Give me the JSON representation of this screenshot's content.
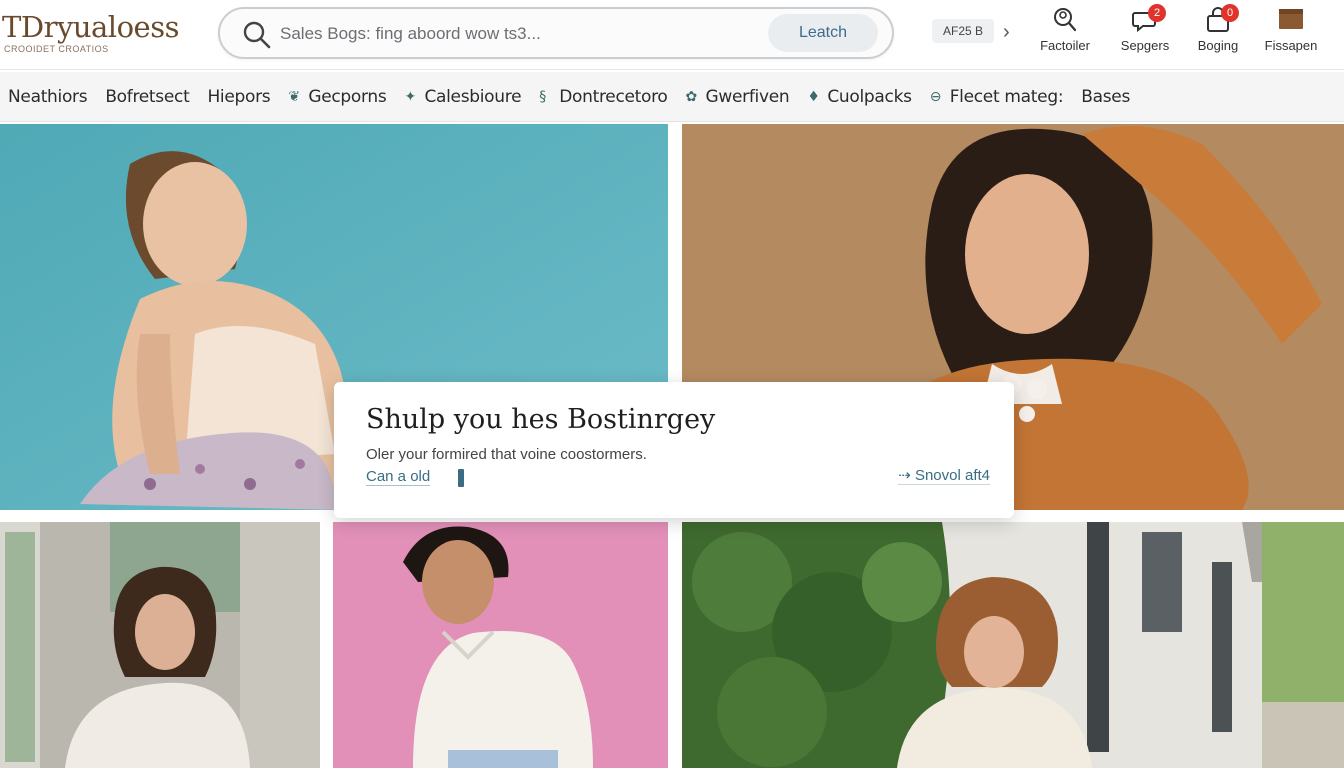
{
  "header": {
    "logo_text": "TDryualoess",
    "logo_tagline": "CROOIDET CROATIOS",
    "search": {
      "placeholder": "Sales Bogs: fing aboord wow ts3...",
      "button_label": "Leatch"
    },
    "locale_label": "AF25 B",
    "icons": [
      {
        "name": "search-person-icon",
        "label": "Factoiler",
        "badge": ""
      },
      {
        "name": "chat-icon",
        "label": "Sepgers",
        "badge": "2"
      },
      {
        "name": "bag-icon",
        "label": "Boging",
        "badge": "0"
      },
      {
        "name": "box-icon",
        "label": "Fissapen",
        "badge": ""
      }
    ]
  },
  "categories": [
    {
      "label": "Neathiors",
      "icon": ""
    },
    {
      "label": "Bofretsect",
      "icon": ""
    },
    {
      "label": "Hiepors",
      "icon": ""
    },
    {
      "label": "Gecporns",
      "icon": "leaf-icon"
    },
    {
      "label": "Calesbioure",
      "icon": "star-icon"
    },
    {
      "label": "Dontrecetoro",
      "icon": "tag-icon"
    },
    {
      "label": "Gwerfiven",
      "icon": "flower-icon"
    },
    {
      "label": "Cuolpacks",
      "icon": "drop-icon"
    },
    {
      "label": "Flecet mateg:",
      "icon": "circle-icon"
    },
    {
      "label": "Bases",
      "icon": ""
    }
  ],
  "promo": {
    "title": "Shulp you hes Bostinrgey",
    "subtitle": "Oler your formired that voine coostormers.",
    "link_label": "Can a old",
    "more_label": "⇢ Snovol aft4"
  },
  "colors": {
    "teal_bg": "#5fb2bf",
    "pink_bg": "#e290b8",
    "tan_wall": "#b98e63",
    "accent": "#3a6d84",
    "badge": "#e0332b"
  }
}
